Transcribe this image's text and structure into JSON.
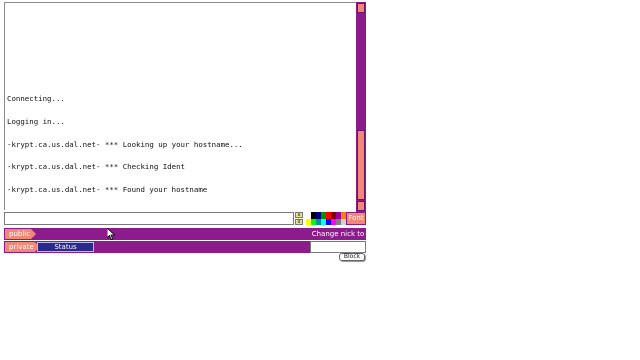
{
  "console": {
    "lines": [
      "Connecting...",
      "Logging in...",
      "-krypt.ca.us.dal.net- *** Looking up your hostname...",
      "-krypt.ca.us.dal.net- *** Checking Ident",
      "-krypt.ca.us.dal.net- *** Found your hostname"
    ]
  },
  "input": {
    "value": ""
  },
  "format_buttons": [
    "a",
    "a"
  ],
  "palette": {
    "colors": [
      "#ffffff",
      "#000000",
      "#00007f",
      "#009300",
      "#ff0000",
      "#7f0000",
      "#9c009c",
      "#fc7f00",
      "#ffff00",
      "#00fc00",
      "#009393",
      "#00ffff",
      "#0000fc",
      "#ff00ff",
      "#7f7f7f",
      "#d2d2d2"
    ]
  },
  "font_button": "Font",
  "tabs": {
    "public": "public",
    "private": "private",
    "status": "Status"
  },
  "nick": {
    "label": "Change nick to",
    "value": ""
  },
  "block_button": "Block",
  "colors": {
    "accent": "#8c1c8c",
    "highlight": "#f08878",
    "status_tab": "#2a2a8a"
  }
}
